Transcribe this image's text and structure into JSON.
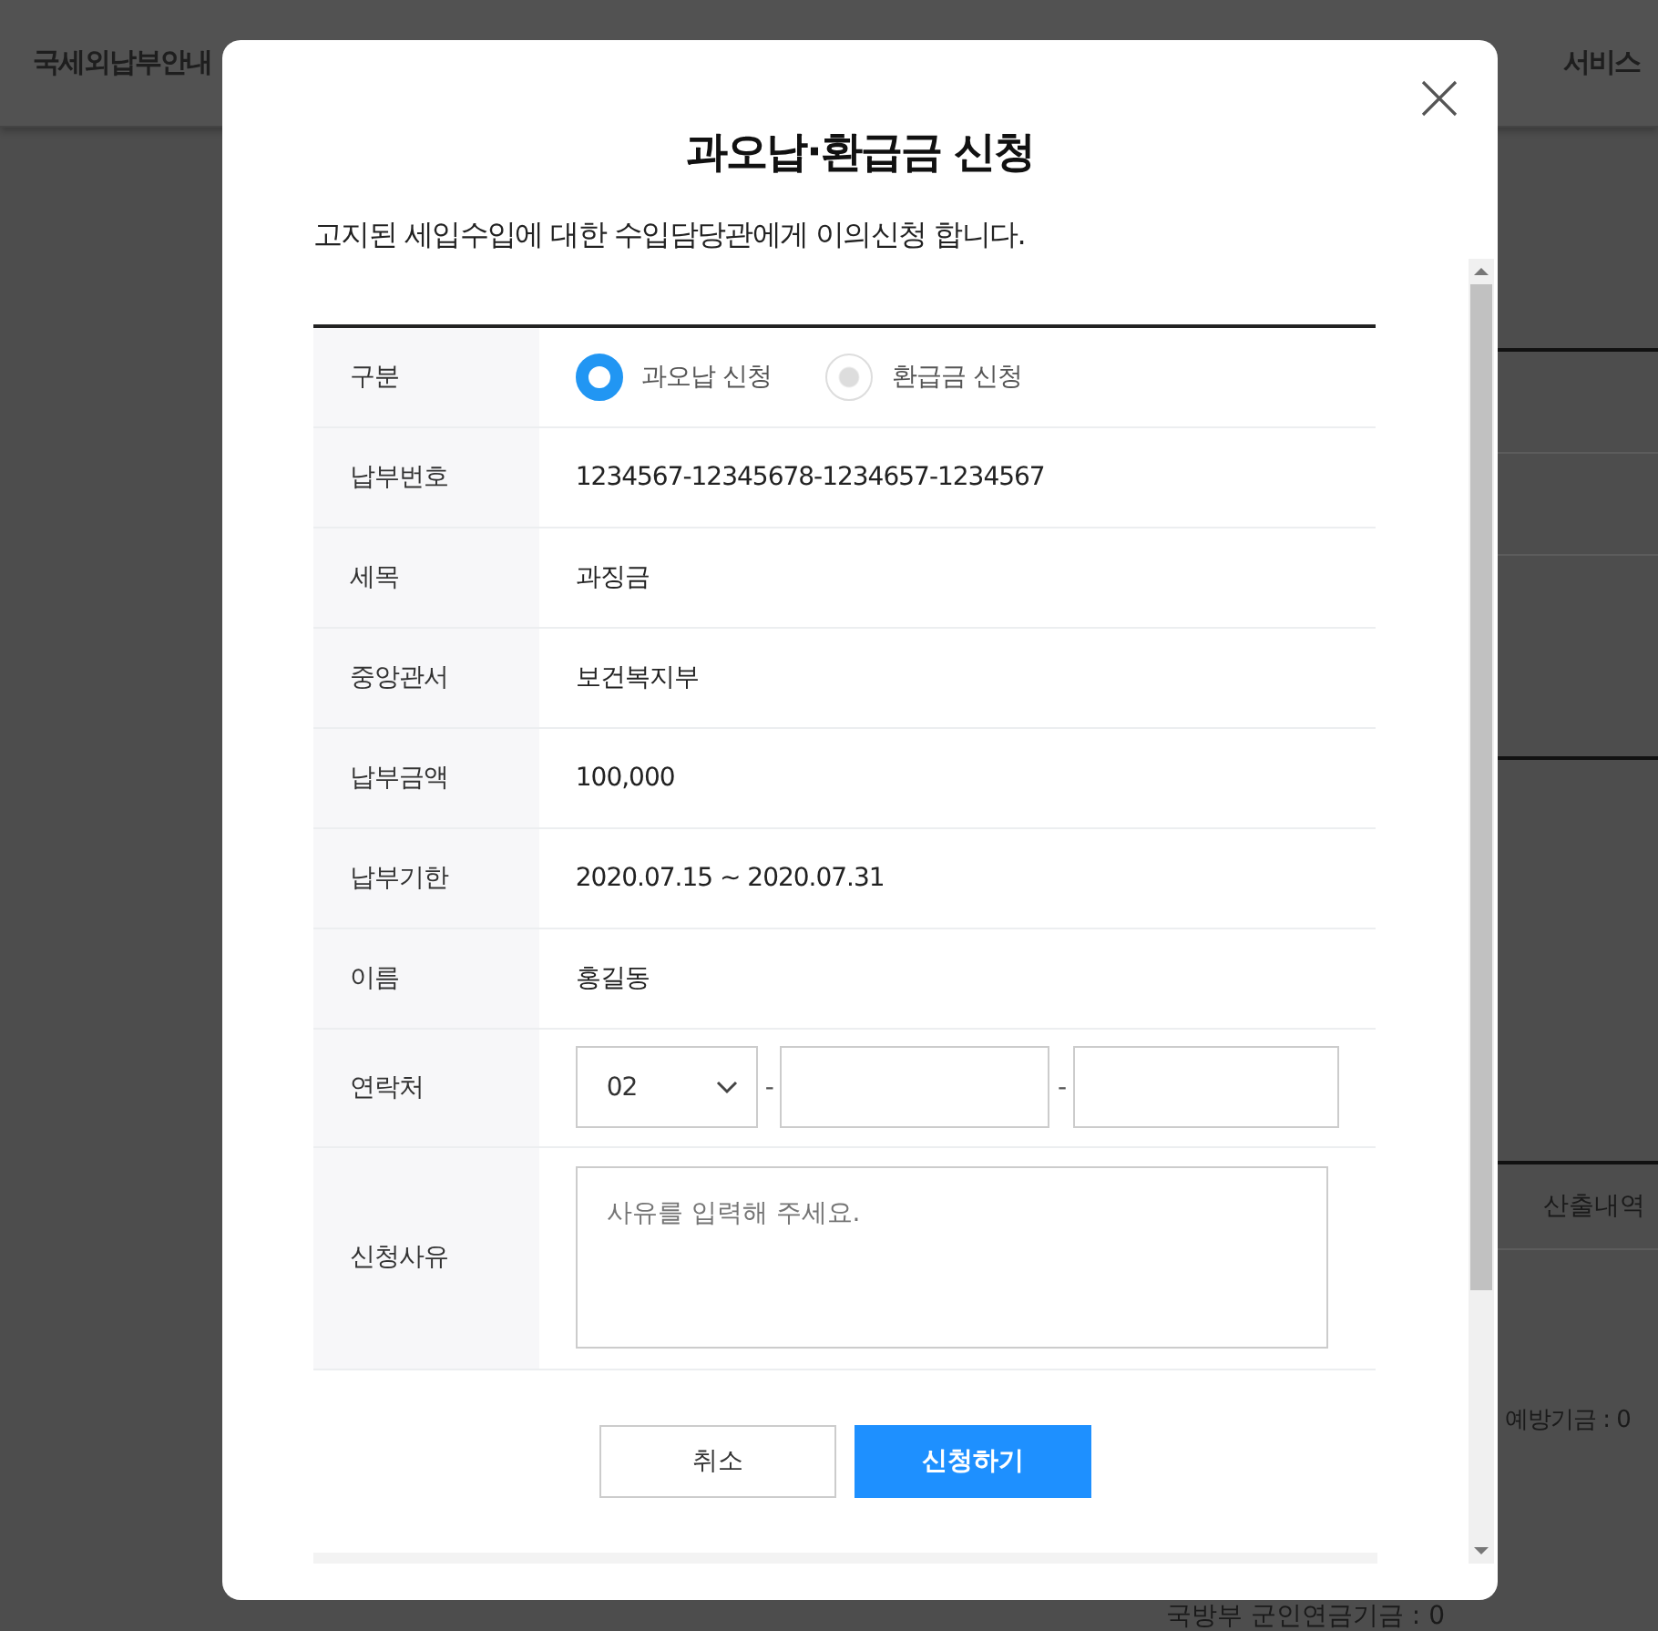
{
  "background": {
    "nav": [
      "국세외납부안내",
      "서비스"
    ],
    "side_texts": [
      "산출내역",
      "예방기금 : 0"
    ],
    "bottom_text": "국방부 군인연금기금 : 0"
  },
  "dialog": {
    "title": "과오납·환급금 신청",
    "description": "고지된 세입수입에 대한 수입담당관에게 이의신청 합니다.",
    "rows": [
      {
        "label": "구분",
        "kind": "radio",
        "options": [
          {
            "label": "과오납 신청",
            "selected": true
          },
          {
            "label": "환급금 신청",
            "selected": false
          }
        ]
      },
      {
        "label": "납부번호",
        "kind": "text",
        "value": "1234567-12345678-1234657-1234567"
      },
      {
        "label": "세목",
        "kind": "text",
        "value": "과징금"
      },
      {
        "label": "중앙관서",
        "kind": "text",
        "value": "보건복지부"
      },
      {
        "label": "납부금액",
        "kind": "text",
        "value": "100,000"
      },
      {
        "label": "납부기한",
        "kind": "text",
        "value": "2020.07.15 ~ 2020.07.31"
      },
      {
        "label": "이름",
        "kind": "text",
        "value": "홍길동"
      },
      {
        "label": "연락처",
        "kind": "contact",
        "area_code": "02",
        "separators": [
          "-",
          "-"
        ]
      },
      {
        "label": "신청사유",
        "kind": "textarea",
        "placeholder": "사유를 입력해 주세요."
      }
    ],
    "buttons": [
      {
        "label": "취소",
        "kind": "secondary"
      },
      {
        "label": "신청하기",
        "kind": "primary"
      }
    ]
  }
}
